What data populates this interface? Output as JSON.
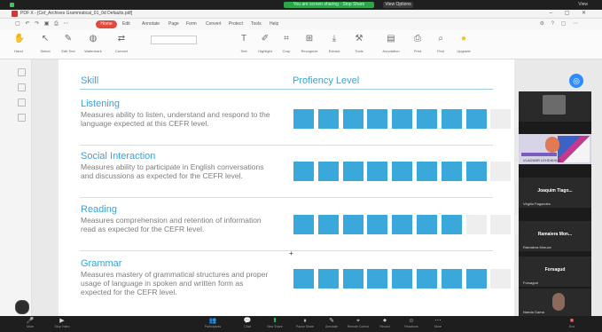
{
  "zoom_top": {
    "share_banner": "You are screen sharing · Stop Share",
    "view_options": "View Options",
    "view_button": "View"
  },
  "window": {
    "title": "PDF X - [Cef_Archives Grammatical_01_0d Defaults.pdf]",
    "controls": "– ▢ ✕"
  },
  "menu": {
    "quick_access": "▢ ↶ ↷ ▣ ⎙ ⋯",
    "home": "Home",
    "items": [
      "Edit",
      "Annotate",
      "Page",
      "Form",
      "Convert",
      "Protect",
      "Tools",
      "Help"
    ],
    "right": "⚙ ? ▢ ⋯"
  },
  "toolbar": {
    "buttons": [
      {
        "icon": "hand-icon",
        "glyph": "✋",
        "label": "Hand"
      },
      {
        "icon": "select-icon",
        "glyph": "↖",
        "label": "Select"
      },
      {
        "icon": "edit-icon",
        "glyph": "✎",
        "label": "Edit Text"
      },
      {
        "icon": "watermark-icon",
        "glyph": "◍",
        "label": "Watermark"
      },
      {
        "icon": "convert-icon",
        "glyph": "⇄",
        "label": "Convert"
      },
      {
        "icon": "text-icon",
        "glyph": "T",
        "label": "Text"
      },
      {
        "icon": "highlight-icon",
        "glyph": "✐",
        "label": "Highlight"
      },
      {
        "icon": "crop-icon",
        "glyph": "⌗",
        "label": "Crop"
      },
      {
        "icon": "ocr-icon",
        "glyph": "⊞",
        "label": "Recognize"
      },
      {
        "icon": "extract-icon",
        "glyph": "⤓",
        "label": "Extract"
      },
      {
        "icon": "tools-icon",
        "glyph": "⚒",
        "label": "Tools"
      },
      {
        "icon": "annotation-icon",
        "glyph": "▤",
        "label": "Annotation"
      },
      {
        "icon": "print-icon",
        "glyph": "⎙",
        "label": "Print"
      },
      {
        "icon": "find-icon",
        "glyph": "⌕",
        "label": "Find"
      },
      {
        "icon": "upgrade-icon",
        "glyph": "●",
        "label": "Upgrade"
      }
    ]
  },
  "document": {
    "header_skill": "Skill",
    "header_level": "Profiency Level",
    "max_level": 10,
    "skills": [
      {
        "name": "Listening",
        "description": "Measures ability to listen, understand and respond to the language expected at this CEFR level.",
        "level": 8
      },
      {
        "name": "Social Interaction",
        "description": "Measures ability to participate in English conversations and discussions as expected for the CEFR level.",
        "level": 8
      },
      {
        "name": "Reading",
        "description": "Measures comprehension and retention of information read as expected for the CEFR level.",
        "level": 7
      },
      {
        "name": "Grammar",
        "description": "Measures mastery of grammatical structures and proper usage of language in spoken and written form as expected for the CEFR level.",
        "level": 8
      }
    ],
    "bar_on_color": "#3ba8dc",
    "bar_off_color": "#eeeeee"
  },
  "participants": [
    {
      "kind": "photo",
      "name": ""
    },
    {
      "kind": "colorful",
      "name": "VLADIMIR LEHDIKHUE"
    },
    {
      "kind": "name",
      "center": "Joaquim Tiago...",
      "name": "Virgilio Fagundes"
    },
    {
      "kind": "name",
      "center": "Ramaiera Mon...",
      "name": "Ramaiera Moruce"
    },
    {
      "kind": "name",
      "center": "Forsagud",
      "name": "Forsagud"
    },
    {
      "kind": "me",
      "name": "Nanda Gama"
    }
  ],
  "controls": [
    {
      "icon": "microphone-icon",
      "glyph": "🎤",
      "label": "Mute"
    },
    {
      "icon": "video-icon",
      "glyph": "▶",
      "label": "Stop Video"
    },
    {
      "icon": "participants-icon",
      "glyph": "👥",
      "label": "Participants"
    },
    {
      "icon": "chat-icon",
      "glyph": "💬",
      "label": "Chat"
    },
    {
      "icon": "share-screen-icon",
      "glyph": "⬆",
      "label": "New Share"
    },
    {
      "icon": "pause-icon",
      "glyph": "⏸",
      "label": "Pause Share"
    },
    {
      "icon": "annotate-icon",
      "glyph": "✎",
      "label": "Annotate"
    },
    {
      "icon": "remote-icon",
      "glyph": "⌖",
      "label": "Remote Control"
    },
    {
      "icon": "record-icon",
      "glyph": "⏺",
      "label": "Record"
    },
    {
      "icon": "reactions-icon",
      "glyph": "☺",
      "label": "Reactions"
    },
    {
      "icon": "more-icon",
      "glyph": "⋯",
      "label": "More"
    }
  ],
  "end_label": "End"
}
